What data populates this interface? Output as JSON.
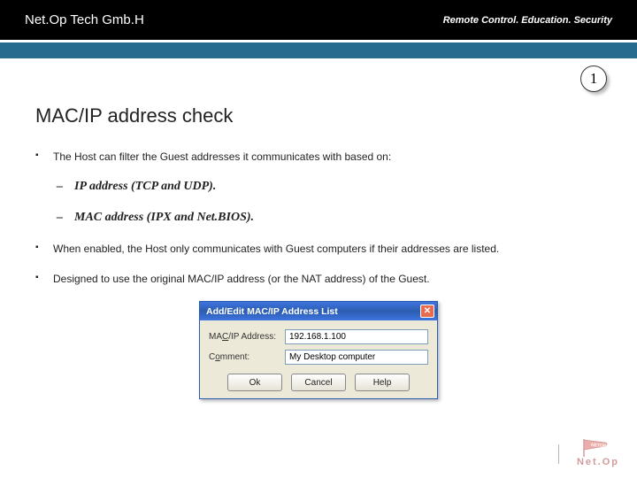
{
  "header": {
    "brand": "Net.Op Tech Gmb.H",
    "tagline": "Remote Control. Education. Security"
  },
  "page_badge": "1",
  "title": "MAC/IP address check",
  "bullets": [
    {
      "text": "The Host can filter the Guest addresses it communicates with based on:",
      "sub": [
        "IP address (TCP and UDP).",
        "MAC address (IPX and Net.BIOS)."
      ]
    },
    {
      "text": "When enabled, the Host only communicates with Guest computers if their addresses are listed."
    },
    {
      "text": "Designed to use the original MAC/IP address (or the NAT address) of the Guest."
    }
  ],
  "dialog": {
    "title": "Add/Edit MAC/IP Address List",
    "fields": {
      "mac_label_pre": "MA",
      "mac_label_ul": "C",
      "mac_label_post": "/IP Address:",
      "mac_value": "192.168.1.100",
      "comment_label_pre": "C",
      "comment_label_ul": "o",
      "comment_label_post": "mment:",
      "comment_value": "My Desktop computer"
    },
    "buttons": {
      "ok": "Ok",
      "cancel": "Cancel",
      "help": "Help"
    },
    "close": "✕"
  },
  "logo": {
    "text": "Net.Op"
  }
}
